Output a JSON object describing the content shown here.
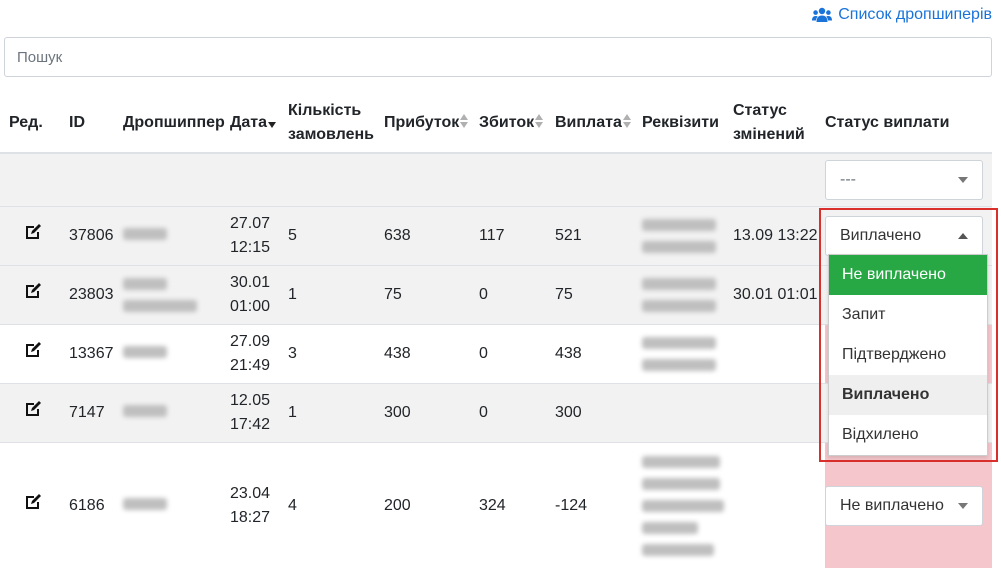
{
  "header": {
    "dropshippers_link": "Список дропшиперів",
    "link_icon": "users-icon"
  },
  "search": {
    "placeholder": "Пошук",
    "value": ""
  },
  "table": {
    "columns": [
      "Ред.",
      "ID",
      "Дропшиппер",
      "Дата",
      "Кількість замовлень",
      "Прибуток",
      "Збиток",
      "Виплата",
      "Реквізити",
      "Статус змінений",
      "Статус виплати"
    ],
    "filter_status": "---",
    "rows": [
      {
        "id": "37806",
        "date": "27.07 12:15",
        "orders": "5",
        "profit": "638",
        "loss": "117",
        "payout": "521",
        "changed": "13.09 13:22",
        "status": "Виплачено",
        "status_color": "#c3e6cb"
      },
      {
        "id": "23803",
        "date": "30.01 01:00",
        "orders": "1",
        "profit": "75",
        "loss": "0",
        "payout": "75",
        "changed": "30.01 01:01",
        "status": "",
        "status_color": "#f5c6cb"
      },
      {
        "id": "13367",
        "date": "27.09 21:49",
        "orders": "3",
        "profit": "438",
        "loss": "0",
        "payout": "438",
        "changed": "",
        "status": "",
        "status_color": "#f5c6cb"
      },
      {
        "id": "7147",
        "date": "12.05 17:42",
        "orders": "1",
        "profit": "300",
        "loss": "0",
        "payout": "300",
        "changed": "",
        "status": "",
        "status_color": "#f5c6cb"
      },
      {
        "id": "6186",
        "date": "23.04 18:27",
        "orders": "4",
        "profit": "200",
        "loss": "324",
        "payout": "-124",
        "changed": "",
        "status": "Не виплачено",
        "status_color": "#f5c6cb"
      }
    ]
  },
  "dropdown": {
    "options": [
      "Не виплачено",
      "Запит",
      "Підтверджено",
      "Виплачено",
      "Відхилено"
    ],
    "highlighted": "Не виплачено",
    "selected": "Виплачено"
  }
}
